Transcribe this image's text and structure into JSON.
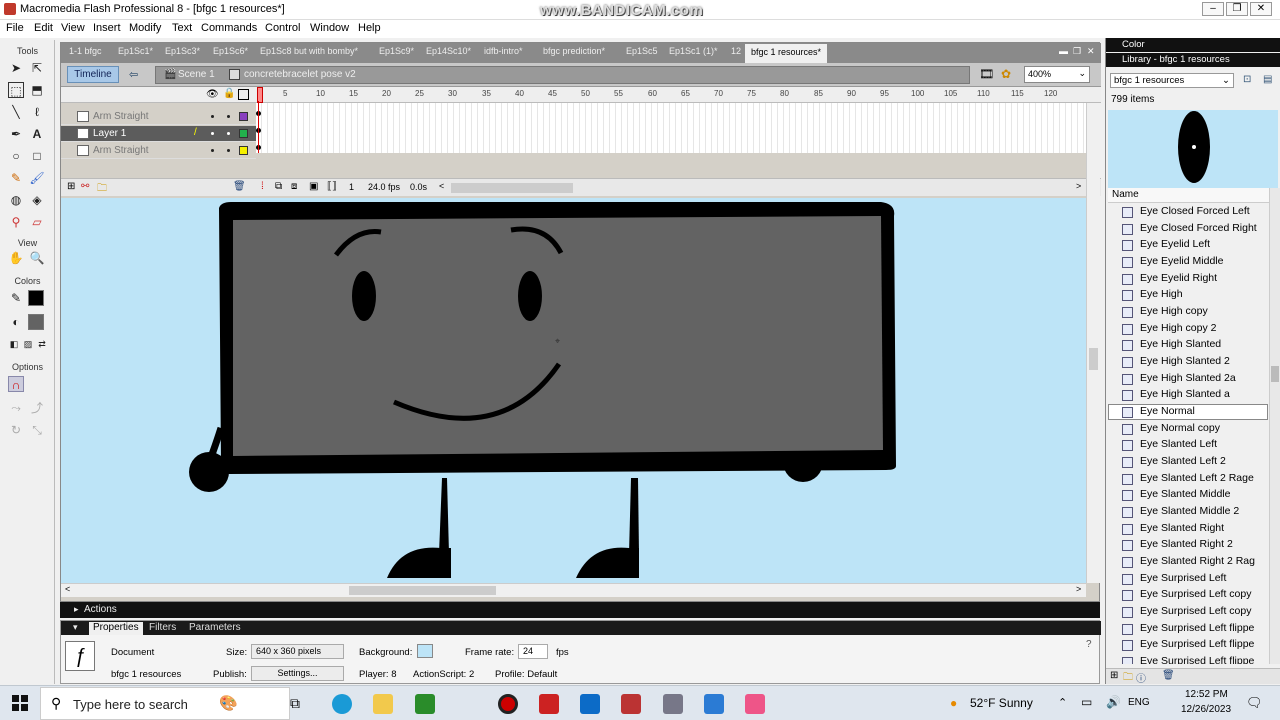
{
  "window": {
    "title": "Macromedia Flash Professional 8 - [bfgc 1 resources*]",
    "watermark": "www.BANDICAM.com"
  },
  "menu": [
    "File",
    "Edit",
    "View",
    "Insert",
    "Modify",
    "Text",
    "Commands",
    "Control",
    "Window",
    "Help"
  ],
  "tools": {
    "header": "Tools",
    "view_label": "View",
    "colors_label": "Colors",
    "options_label": "Options"
  },
  "doc_tabs": [
    "1-1 bfgc",
    "Ep1Sc1*",
    "Ep1Sc3*",
    "Ep1Sc6*",
    "Ep1Sc8 but with bomby*",
    "Ep1Sc9*",
    "Ep14Sc10*",
    "idfb-intro*",
    "bfgc prediction*",
    "Ep1Sc5",
    "Ep1Sc1 (1)*",
    "12",
    "bfgc 1 resources*"
  ],
  "editbar": {
    "timeline_btn": "Timeline",
    "scene": "Scene 1",
    "symbol": "concretebracelet pose v2",
    "zoom": "400%"
  },
  "timeline": {
    "ticks": [
      "5",
      "10",
      "15",
      "20",
      "25",
      "30",
      "35",
      "40",
      "45",
      "50",
      "55",
      "60",
      "65",
      "70",
      "75",
      "80",
      "85",
      "90",
      "95",
      "100",
      "105",
      "110",
      "115",
      "120"
    ],
    "layers": [
      {
        "name": "Arm Straight",
        "color": "#8a3fbf",
        "selected": false
      },
      {
        "name": "Layer 1",
        "color": "#22b14c",
        "selected": true
      },
      {
        "name": "Arm Straight",
        "color": "#f5f000",
        "selected": false
      }
    ],
    "footer": {
      "frame": "1",
      "fps": "24.0 fps",
      "time": "0.0s"
    }
  },
  "panels": {
    "actions": "Actions",
    "prop_tabs": [
      "Properties",
      "Filters",
      "Parameters"
    ]
  },
  "properties": {
    "type": "Document",
    "name": "bfgc 1 resources",
    "size_label": "Size:",
    "size_value": "640 x 360 pixels",
    "background_label": "Background:",
    "frame_rate_label": "Frame rate:",
    "frame_rate_value": "24",
    "fps_unit": "fps",
    "publish_label": "Publish:",
    "settings_btn": "Settings...",
    "player": "Player: 8",
    "actionscript": "ActionScript: 2",
    "profile": "Profile: Default"
  },
  "library": {
    "color_header": "Color",
    "header": "Library - bfgc 1 resources",
    "dropdown": "bfgc 1 resources",
    "count": "799 items",
    "name_col": "Name",
    "items": [
      "Eye Closed Forced Left",
      "Eye Closed Forced Right",
      "Eye Eyelid Left",
      "Eye Eyelid Middle",
      "Eye Eyelid Right",
      "Eye High",
      "Eye High copy",
      "Eye High copy 2",
      "Eye High Slanted",
      "Eye High Slanted 2",
      "Eye High Slanted 2a",
      "Eye High Slanted a",
      "Eye Normal",
      "Eye Normal copy",
      "Eye Slanted Left",
      "Eye Slanted Left 2",
      "Eye Slanted Left 2 Rage",
      "Eye Slanted Middle",
      "Eye Slanted Middle 2",
      "Eye Slanted Right",
      "Eye Slanted Right 2",
      "Eye Slanted Right 2 Rag",
      "Eye Surprised Left",
      "Eye Surprised Left copy",
      "Eye Surprised Left copy",
      "Eye Surprised Left flippe",
      "Eye Surprised Left flippe",
      "Eye Surprised Left flippe"
    ],
    "selected_index": 12
  },
  "taskbar": {
    "search_placeholder": "Type here to search",
    "weather": "52°F  Sunny",
    "lang": "ENG",
    "time": "12:52 PM",
    "date": "12/26/2023"
  },
  "colors": {
    "stage": "#bde4f7",
    "object": "#636363",
    "outline": "#000000"
  }
}
